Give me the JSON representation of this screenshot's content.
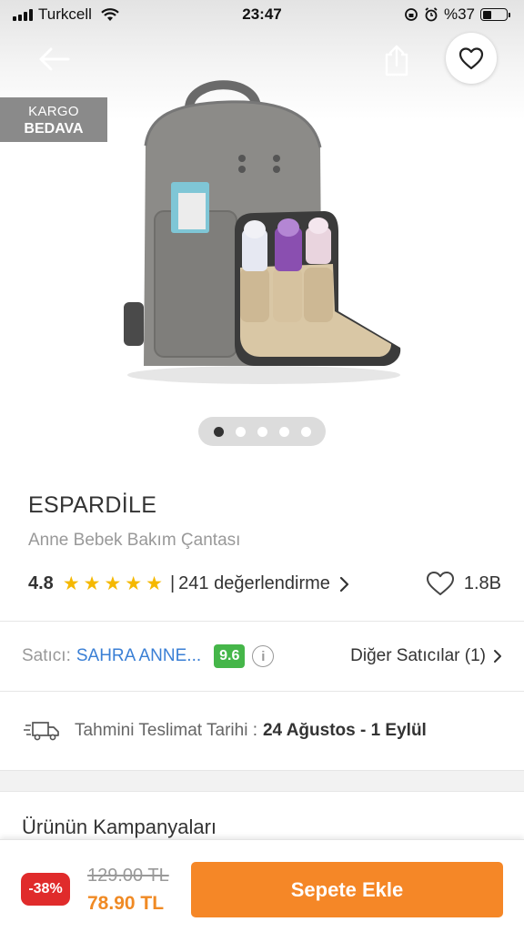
{
  "status_bar": {
    "carrier": "Turkcell",
    "time": "23:47",
    "battery": "%37",
    "battery_level": 0.37
  },
  "hero": {
    "badge_line1": "KARGO",
    "badge_line2": "BEDAVA",
    "image_count": 5,
    "active_image": 1
  },
  "product": {
    "brand": "ESPARDİLE",
    "name": "Anne Bebek Bakım Çantası",
    "rating": "4.8",
    "stars": 5,
    "separator": "|",
    "reviews": "241 değerlendirme",
    "favorites": "1.8B"
  },
  "seller": {
    "label": "Satıcı:",
    "name": "SAHRA ANNE...",
    "score": "9.6",
    "info": "i",
    "other_sellers": "Diğer Satıcılar (1)"
  },
  "delivery": {
    "label": "Tahmini Teslimat Tarihi :",
    "date": "24 Ağustos - 1 Eylül"
  },
  "campaigns": {
    "title": "Ürünün Kampanyaları"
  },
  "bottom_bar": {
    "discount": "-38%",
    "old_price": "129.00 TL",
    "new_price": "78.90 TL",
    "add_to_cart": "Sepete Ekle"
  },
  "colors": {
    "accent": "#f58727",
    "seller_link": "#3a7fd5",
    "score_green": "#45b649",
    "star": "#f5b800",
    "discount_red": "#e02b2b"
  }
}
